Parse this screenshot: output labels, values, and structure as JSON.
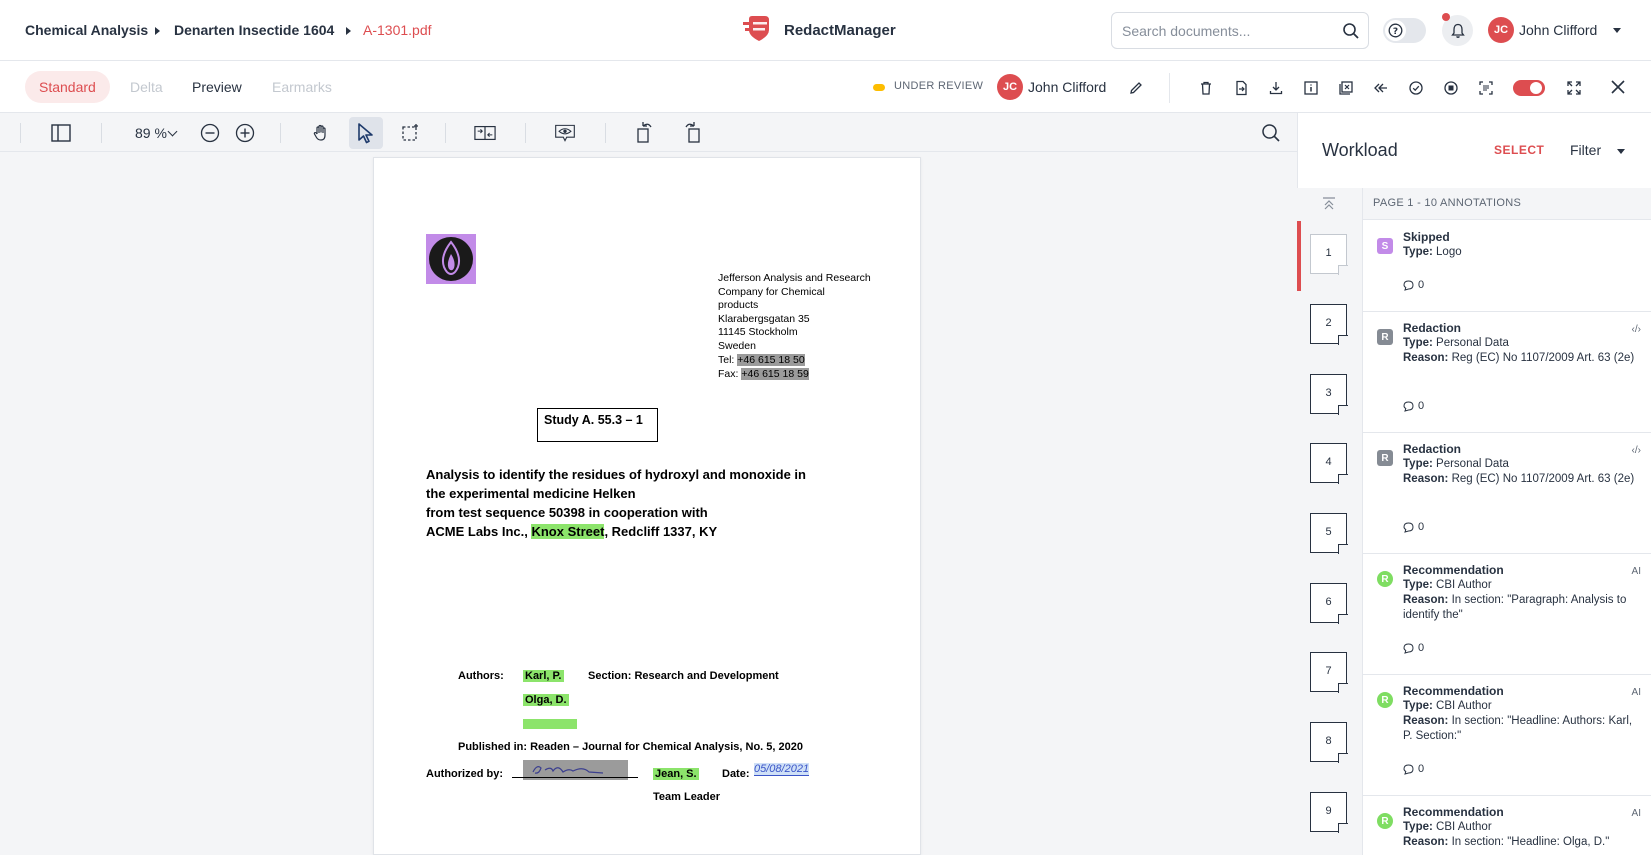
{
  "breadcrumb": {
    "items": [
      "Chemical Analysis",
      "Denarten Insectide 1604",
      "A-1301.pdf"
    ]
  },
  "brand": {
    "name": "RedactManager"
  },
  "search": {
    "placeholder": "Search documents..."
  },
  "user": {
    "initials": "JC",
    "name": "John Clifford"
  },
  "view_tabs": [
    {
      "label": "Standard",
      "state": "active"
    },
    {
      "label": "Delta",
      "state": "disabled"
    },
    {
      "label": "Preview",
      "state": "normal"
    },
    {
      "label": "Earmarks",
      "state": "disabled"
    }
  ],
  "review": {
    "status": "UNDER REVIEW",
    "assignee_initials": "JC",
    "assignee_name": "John Clifford"
  },
  "toolbar": {
    "zoom": "89 %"
  },
  "colors": {
    "accent": "#dd4d50",
    "status_pending": "#fdbd00",
    "highlight_green": "#8ce46b",
    "skipped": "#c28be8",
    "recommendation": "#7fdd62"
  },
  "document": {
    "company": [
      "Jefferson Analysis and Research",
      "Company for Chemical",
      "products",
      "Klarabergsgatan 35",
      "11145 Stockholm",
      "Sweden"
    ],
    "tel_label": "Tel:",
    "tel": "+46 615 18 50",
    "fax_label": "Fax:",
    "fax": "+46 615 18 59",
    "study": "Study A. 55.3 – 1",
    "title_lines": [
      "Analysis to identify the residues of hydroxyl and monoxide in",
      "the experimental medicine Helken",
      "from test sequence 50398 in cooperation with"
    ],
    "title_line4_pre": "ACME Labs Inc., ",
    "title_line4_hl": "Knox Street",
    "title_line4_post": ", Redcliff 1337, KY",
    "authors_label": "Authors:",
    "author1": "Karl, P.",
    "author2": "Olga, D.",
    "section": "Section: Research and Development",
    "published": "Published in: Readen – Journal for Chemical Analysis, No. 5, 2020",
    "authorized_label": "Authorized by:",
    "authorized_name": "Jean, S.",
    "date_label": "Date:",
    "date_value": "05/08/2021",
    "role": "Team Leader"
  },
  "workload": {
    "title": "Workload",
    "select_label": "SELECT",
    "filter_label": "Filter",
    "annotations_header": "PAGE 1 - 10 ANNOTATIONS",
    "pages": [
      "1",
      "2",
      "3",
      "4",
      "5",
      "6",
      "7",
      "8",
      "9"
    ],
    "annotations": [
      {
        "badge": "S",
        "kind": "skip",
        "title": "Skipped",
        "type_label": "Type:",
        "type": "Logo",
        "reason_label": "",
        "reason": "",
        "comments": "0",
        "side": ""
      },
      {
        "badge": "R",
        "kind": "red",
        "title": "Redaction",
        "type_label": "Type:",
        "type": "Personal Data",
        "reason_label": "Reason:",
        "reason": "Reg (EC) No 1107/2009 Art. 63 (2e)",
        "comments": "0",
        "side": "‹/›"
      },
      {
        "badge": "R",
        "kind": "red",
        "title": "Redaction",
        "type_label": "Type:",
        "type": "Personal Data",
        "reason_label": "Reason:",
        "reason": "Reg (EC) No 1107/2009 Art. 63 (2e)",
        "comments": "0",
        "side": "‹/›"
      },
      {
        "badge": "R",
        "kind": "rec",
        "title": "Recommendation",
        "type_label": "Type:",
        "type": "CBI Author",
        "reason_label": "Reason:",
        "reason": "In section: \"Paragraph: Analysis to identify the\"",
        "comments": "0",
        "side": "AI"
      },
      {
        "badge": "R",
        "kind": "rec",
        "title": "Recommendation",
        "type_label": "Type:",
        "type": "CBI Author",
        "reason_label": "Reason:",
        "reason": "In section: \"Headline: Authors: Karl, P. Section:\"",
        "comments": "0",
        "side": "AI"
      },
      {
        "badge": "R",
        "kind": "rec",
        "title": "Recommendation",
        "type_label": "Type:",
        "type": "CBI Author",
        "reason_label": "Reason:",
        "reason": "In section: \"Headline: Olga, D.\"",
        "comments": "",
        "side": "AI"
      }
    ]
  }
}
